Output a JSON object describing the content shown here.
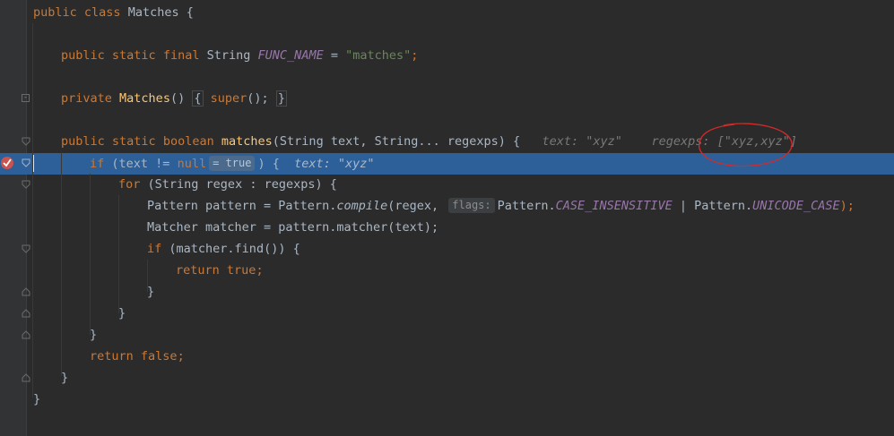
{
  "code": {
    "l1": {
      "kw1": "public",
      "kw2": "class",
      "name": "Matches",
      "brace": "{"
    },
    "l2": {
      "kw1": "public",
      "kw2": "static",
      "kw3": "final",
      "type": "String",
      "const": "FUNC_NAME",
      "eq": "=",
      "str": "\"matches\"",
      "semi": ";"
    },
    "l3": {
      "kw1": "private",
      "name": "Matches",
      "paren": "()",
      "ob": "{",
      "sup": "super",
      "call": "();",
      "cb": "}"
    },
    "l4": {
      "kw1": "public",
      "kw2": "static",
      "kw3": "boolean",
      "name": "matches",
      "params": "(String text, String... regexps) {",
      "hint1": "text: \"xyz\"",
      "hint2": "regexps: [\"xyz,xyz\"]"
    },
    "l5": {
      "kw": "if",
      "pre": "(text != ",
      "null": "null",
      "pill": "= true",
      "post": ") {",
      "hint": "text: \"xyz\""
    },
    "l6": {
      "kw": "for",
      "rest": "(String regex : regexps) {"
    },
    "l7": {
      "pre": "Pattern pattern = Pattern.",
      "method": "compile",
      "mid": "(regex,",
      "pill": "flags:",
      "cls1": "Pattern.",
      "c1": "CASE_INSENSITIVE",
      "bar": " | Pattern.",
      "c2": "UNICODE_CASE",
      "end": ");"
    },
    "l8": {
      "text": "Matcher matcher = pattern.matcher(text);"
    },
    "l9": {
      "kw": "if",
      "rest": "(matcher.find()) {"
    },
    "l10": {
      "kw": "return",
      "val": "true",
      "semi": ";"
    },
    "l11": {
      "brace": "}"
    },
    "l12": {
      "brace": "}"
    },
    "l13": {
      "brace": "}"
    },
    "l14": {
      "kw": "return",
      "val": "false",
      "semi": ";"
    },
    "l15": {
      "brace": "}"
    },
    "l16": {
      "brace": "}"
    }
  },
  "colors": {
    "keyword": "#cc7832",
    "method": "#ffc66d",
    "string": "#6a8759",
    "constant": "#9876aa",
    "text": "#a9b7c6",
    "exec_line": "#2d5f98",
    "annotation_circle": "#d42a2a"
  },
  "icons": {
    "breakpoint": "breakpoint-check-icon",
    "fold": "fold-marker-icon"
  }
}
